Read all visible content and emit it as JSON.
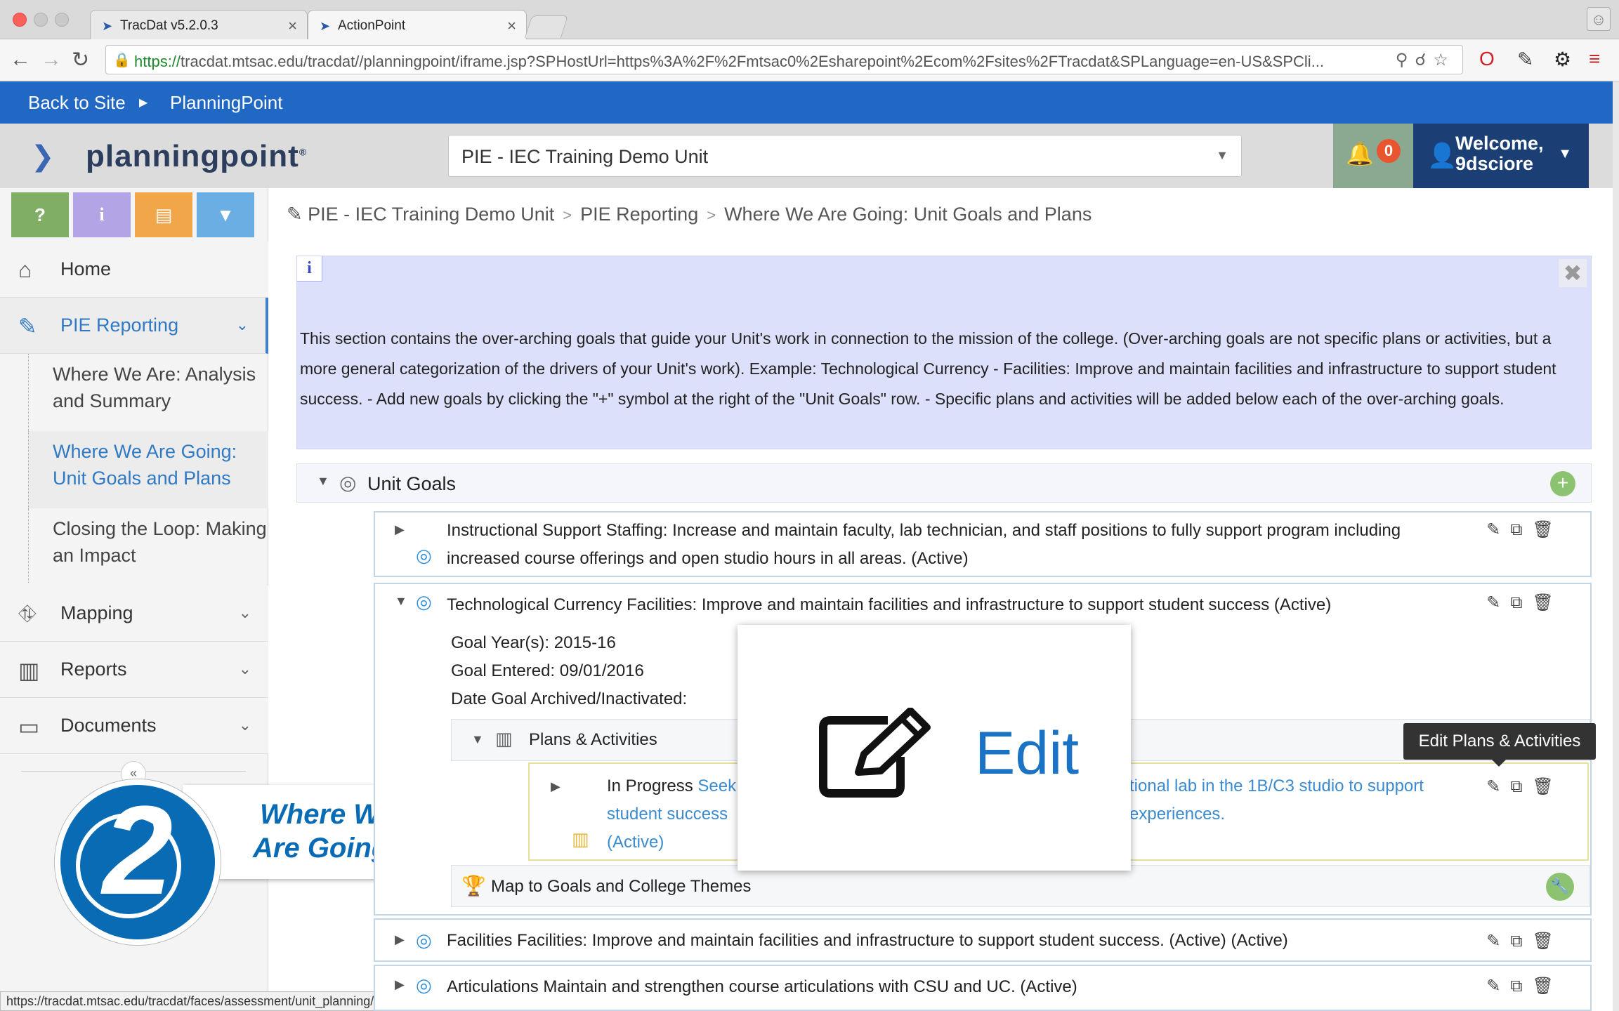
{
  "browser": {
    "tabs": [
      {
        "title": "TracDat v5.2.0.3",
        "active": false
      },
      {
        "title": "ActionPoint",
        "active": true
      }
    ],
    "url_scheme": "https://",
    "url_rest": "tracdat.mtsac.edu/tracdat//planningpoint/iframe.jsp?SPHostUrl=https%3A%2F%2Fmtsac0%2Esharepoint%2Ecom%2Fsites%2FTracdat&SPLanguage=en-US&SPCli...",
    "status_url": "https://tracdat.mtsac.edu/tracdat/faces/assessment/unit_planning/assessmentPlan.xhtml#"
  },
  "sitebar": {
    "back_label": "Back to Site",
    "current_label": "PlanningPoint"
  },
  "header": {
    "logo_text": "planningpoint",
    "logo_mark": "®",
    "unit_selected": "PIE - IEC Training Demo Unit",
    "notif_count": "0",
    "welcome_line1": "Welcome,",
    "welcome_line2": "9dsciore"
  },
  "quick_buttons": [
    {
      "label": "?",
      "color": "#7fae64"
    },
    {
      "label": "i",
      "color": "#b3a4e6"
    },
    {
      "label": "▤",
      "color": "#f1a64a"
    },
    {
      "label": "▼",
      "color": "#6aaee3"
    }
  ],
  "sidebar": {
    "home": "Home",
    "pie": "PIE Reporting",
    "sub_items": [
      "Where We Are: Analysis and Summary",
      "Where We Are Going: Unit Goals and Plans",
      "Closing the Loop: Making an Impact"
    ],
    "mapping": "Mapping",
    "reports": "Reports",
    "documents": "Documents"
  },
  "badge": {
    "number": "2",
    "line1": "Where We",
    "line2": "Are Going"
  },
  "breadcrumb": {
    "c1": "PIE - IEC Training Demo Unit",
    "c2": "PIE Reporting",
    "c3": "Where We Are Going: Unit Goals and Plans"
  },
  "info": {
    "text": "This section contains the over-arching goals that guide your Unit's work in connection to the mission of the college. (Over-arching goals are not specific plans or activities, but a more general categorization of the drivers of your Unit's work). Example: Technological Currency - Facilities: Improve and maintain facilities and infrastructure to support student success. - Add new goals by clicking the \"+\" symbol at the right of the \"Unit Goals\" row. - Specific plans and activities will be added below each of the over-arching goals."
  },
  "unit_goals": {
    "label": "Unit Goals",
    "goals": [
      {
        "text": "Instructional Support Staffing: Increase and maintain faculty, lab technician, and staff positions to fully support program including increased course offerings and open studio hours in all areas. (Active)"
      },
      {
        "text": "Technological Currency Facilities: Improve and maintain facilities and infrastructure to support student success (Active)"
      },
      {
        "text": "Facilities Facilities: Improve and maintain facilities and infrastructure to support student success. (Active) (Active)"
      },
      {
        "text": "Articulations Maintain and strengthen course articulations with CSU and UC. (Active)"
      }
    ]
  },
  "goal_detail": {
    "year": "Goal Year(s): 2015-16",
    "entered": "Goal Entered: 09/01/2016",
    "archived": "Date Goal Archived/Inactivated:",
    "plans_label": "Plans & Activities",
    "plan_status": "In Progress",
    "plan_link_start": "Seek",
    "plan_link_end": "tional lab in the 1B/C3 studio to support",
    "plan_line2_start": "student success",
    "plan_line2_end": "experiences.",
    "plan_active": "(Active)",
    "map_label": "Map to Goals and College Themes"
  },
  "tooltip": "Edit Plans & Activities",
  "overlay": {
    "label": "Edit"
  }
}
